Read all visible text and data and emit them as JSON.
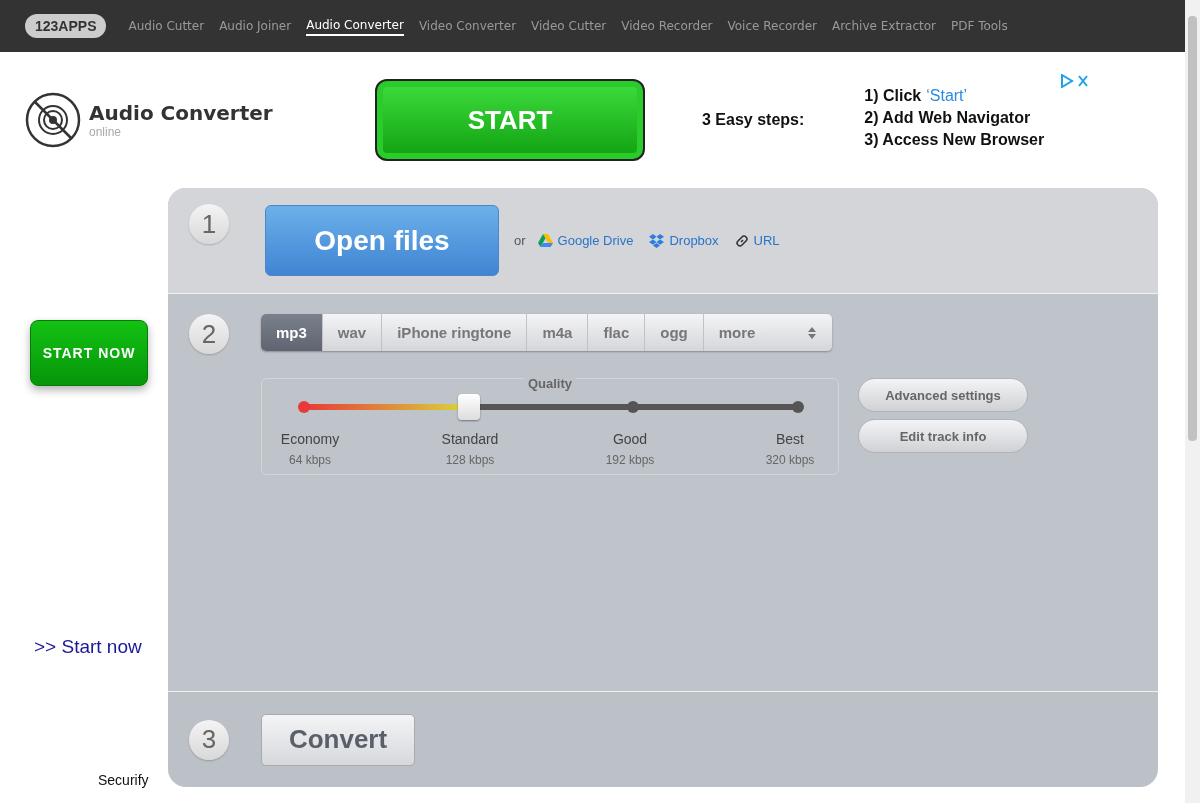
{
  "nav": {
    "logo": "123APPS",
    "items": [
      {
        "label": "Audio Cutter",
        "selected": false
      },
      {
        "label": "Audio Joiner",
        "selected": false
      },
      {
        "label": "Audio Converter",
        "selected": true
      },
      {
        "label": "Video Converter",
        "selected": false
      },
      {
        "label": "Video Cutter",
        "selected": false
      },
      {
        "label": "Video Recorder",
        "selected": false
      },
      {
        "label": "Voice Recorder",
        "selected": false
      },
      {
        "label": "Archive Extractor",
        "selected": false
      },
      {
        "label": "PDF Tools",
        "selected": false
      }
    ]
  },
  "app": {
    "title": "Audio Converter",
    "subtitle": "online"
  },
  "ad": {
    "button": "START",
    "heading": "3 Easy steps:",
    "steps": [
      {
        "lead": "1) Click",
        "tail": "‘Start’",
        "kind": "link"
      },
      {
        "lead": "2) Add",
        "tail": "Web Navigator",
        "kind": "bold"
      },
      {
        "lead": "3) Access New Browser"
      }
    ]
  },
  "side": {
    "button": "START NOW",
    "link": ">> Start now",
    "footer": "Securify"
  },
  "step1": {
    "number": "1",
    "button": "Open files",
    "or": "or",
    "sources": [
      {
        "label": "Google Drive",
        "kind": "drive"
      },
      {
        "label": "Dropbox",
        "kind": "dropbox"
      },
      {
        "label": "URL",
        "kind": "link"
      }
    ]
  },
  "step2": {
    "number": "2",
    "formats": [
      {
        "label": "mp3",
        "selected": true,
        "kind": "tab"
      },
      {
        "label": "wav",
        "selected": false,
        "kind": "tab"
      },
      {
        "label": "iPhone ringtone",
        "selected": false,
        "kind": "tab"
      },
      {
        "label": "m4a",
        "selected": false,
        "kind": "tab"
      },
      {
        "label": "flac",
        "selected": false,
        "kind": "tab"
      },
      {
        "label": "ogg",
        "selected": false,
        "kind": "tab"
      },
      {
        "label": "more",
        "selected": false,
        "kind": "select"
      }
    ],
    "quality": {
      "title": "Quality",
      "level": 0.333,
      "points": [
        {
          "label": "Economy",
          "reading": "64 kbps"
        },
        {
          "label": "Standard",
          "reading": "128 kbps"
        },
        {
          "label": "Good",
          "reading": "192 kbps"
        },
        {
          "label": "Best",
          "reading": "320 kbps"
        }
      ]
    },
    "buttons": [
      "Advanced settings",
      "Edit track info"
    ]
  },
  "step3": {
    "number": "3",
    "button": "Convert"
  }
}
